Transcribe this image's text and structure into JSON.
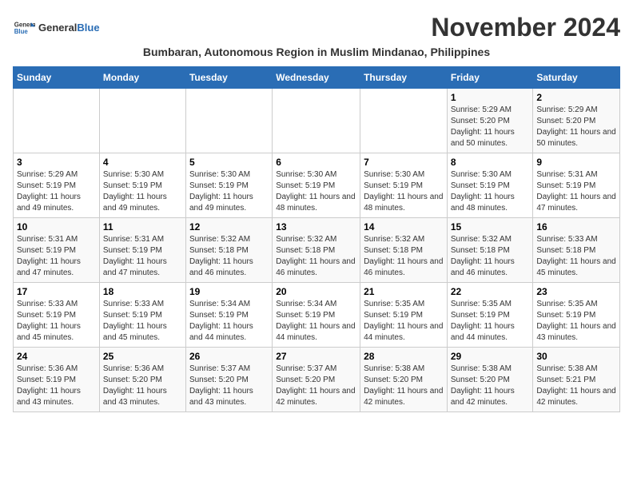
{
  "logo": {
    "text_general": "General",
    "text_blue": "Blue"
  },
  "title": "November 2024",
  "subtitle": "Bumbaran, Autonomous Region in Muslim Mindanao, Philippines",
  "headers": [
    "Sunday",
    "Monday",
    "Tuesday",
    "Wednesday",
    "Thursday",
    "Friday",
    "Saturday"
  ],
  "weeks": [
    [
      {
        "day": "",
        "info": ""
      },
      {
        "day": "",
        "info": ""
      },
      {
        "day": "",
        "info": ""
      },
      {
        "day": "",
        "info": ""
      },
      {
        "day": "",
        "info": ""
      },
      {
        "day": "1",
        "info": "Sunrise: 5:29 AM\nSunset: 5:20 PM\nDaylight: 11 hours and 50 minutes."
      },
      {
        "day": "2",
        "info": "Sunrise: 5:29 AM\nSunset: 5:20 PM\nDaylight: 11 hours and 50 minutes."
      }
    ],
    [
      {
        "day": "3",
        "info": "Sunrise: 5:29 AM\nSunset: 5:19 PM\nDaylight: 11 hours and 49 minutes."
      },
      {
        "day": "4",
        "info": "Sunrise: 5:30 AM\nSunset: 5:19 PM\nDaylight: 11 hours and 49 minutes."
      },
      {
        "day": "5",
        "info": "Sunrise: 5:30 AM\nSunset: 5:19 PM\nDaylight: 11 hours and 49 minutes."
      },
      {
        "day": "6",
        "info": "Sunrise: 5:30 AM\nSunset: 5:19 PM\nDaylight: 11 hours and 48 minutes."
      },
      {
        "day": "7",
        "info": "Sunrise: 5:30 AM\nSunset: 5:19 PM\nDaylight: 11 hours and 48 minutes."
      },
      {
        "day": "8",
        "info": "Sunrise: 5:30 AM\nSunset: 5:19 PM\nDaylight: 11 hours and 48 minutes."
      },
      {
        "day": "9",
        "info": "Sunrise: 5:31 AM\nSunset: 5:19 PM\nDaylight: 11 hours and 47 minutes."
      }
    ],
    [
      {
        "day": "10",
        "info": "Sunrise: 5:31 AM\nSunset: 5:19 PM\nDaylight: 11 hours and 47 minutes."
      },
      {
        "day": "11",
        "info": "Sunrise: 5:31 AM\nSunset: 5:19 PM\nDaylight: 11 hours and 47 minutes."
      },
      {
        "day": "12",
        "info": "Sunrise: 5:32 AM\nSunset: 5:18 PM\nDaylight: 11 hours and 46 minutes."
      },
      {
        "day": "13",
        "info": "Sunrise: 5:32 AM\nSunset: 5:18 PM\nDaylight: 11 hours and 46 minutes."
      },
      {
        "day": "14",
        "info": "Sunrise: 5:32 AM\nSunset: 5:18 PM\nDaylight: 11 hours and 46 minutes."
      },
      {
        "day": "15",
        "info": "Sunrise: 5:32 AM\nSunset: 5:18 PM\nDaylight: 11 hours and 46 minutes."
      },
      {
        "day": "16",
        "info": "Sunrise: 5:33 AM\nSunset: 5:18 PM\nDaylight: 11 hours and 45 minutes."
      }
    ],
    [
      {
        "day": "17",
        "info": "Sunrise: 5:33 AM\nSunset: 5:19 PM\nDaylight: 11 hours and 45 minutes."
      },
      {
        "day": "18",
        "info": "Sunrise: 5:33 AM\nSunset: 5:19 PM\nDaylight: 11 hours and 45 minutes."
      },
      {
        "day": "19",
        "info": "Sunrise: 5:34 AM\nSunset: 5:19 PM\nDaylight: 11 hours and 44 minutes."
      },
      {
        "day": "20",
        "info": "Sunrise: 5:34 AM\nSunset: 5:19 PM\nDaylight: 11 hours and 44 minutes."
      },
      {
        "day": "21",
        "info": "Sunrise: 5:35 AM\nSunset: 5:19 PM\nDaylight: 11 hours and 44 minutes."
      },
      {
        "day": "22",
        "info": "Sunrise: 5:35 AM\nSunset: 5:19 PM\nDaylight: 11 hours and 44 minutes."
      },
      {
        "day": "23",
        "info": "Sunrise: 5:35 AM\nSunset: 5:19 PM\nDaylight: 11 hours and 43 minutes."
      }
    ],
    [
      {
        "day": "24",
        "info": "Sunrise: 5:36 AM\nSunset: 5:19 PM\nDaylight: 11 hours and 43 minutes."
      },
      {
        "day": "25",
        "info": "Sunrise: 5:36 AM\nSunset: 5:20 PM\nDaylight: 11 hours and 43 minutes."
      },
      {
        "day": "26",
        "info": "Sunrise: 5:37 AM\nSunset: 5:20 PM\nDaylight: 11 hours and 43 minutes."
      },
      {
        "day": "27",
        "info": "Sunrise: 5:37 AM\nSunset: 5:20 PM\nDaylight: 11 hours and 42 minutes."
      },
      {
        "day": "28",
        "info": "Sunrise: 5:38 AM\nSunset: 5:20 PM\nDaylight: 11 hours and 42 minutes."
      },
      {
        "day": "29",
        "info": "Sunrise: 5:38 AM\nSunset: 5:20 PM\nDaylight: 11 hours and 42 minutes."
      },
      {
        "day": "30",
        "info": "Sunrise: 5:38 AM\nSunset: 5:21 PM\nDaylight: 11 hours and 42 minutes."
      }
    ]
  ]
}
